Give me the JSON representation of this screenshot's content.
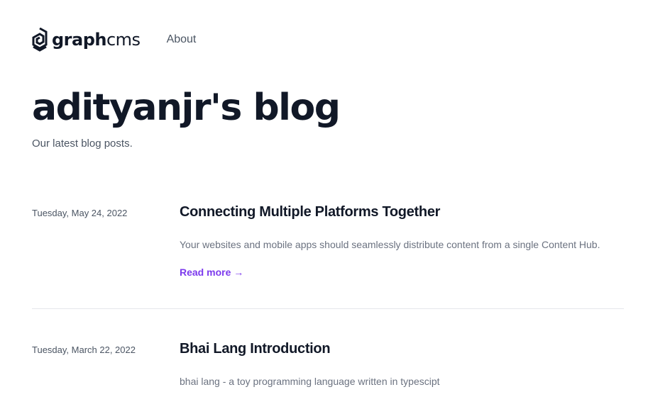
{
  "brand": {
    "logo_bold": "graph",
    "logo_light": "cms"
  },
  "nav": {
    "about_label": "About"
  },
  "hero": {
    "title": "adityanjr's blog",
    "subtitle": "Our latest blog posts."
  },
  "posts": [
    {
      "date": "Tuesday, May 24, 2022",
      "title": "Connecting Multiple Platforms Together",
      "excerpt": "Your websites and mobile apps should seamlessly distribute content from a single Content Hub.",
      "read_more": "Read more →"
    },
    {
      "date": "Tuesday, March 22, 2022",
      "title": "Bhai Lang Introduction",
      "excerpt": "bhai lang - a toy programming language written in typescipt"
    }
  ],
  "colors": {
    "accent": "#7c3aed",
    "heading": "#111827",
    "muted": "#6b7280"
  }
}
